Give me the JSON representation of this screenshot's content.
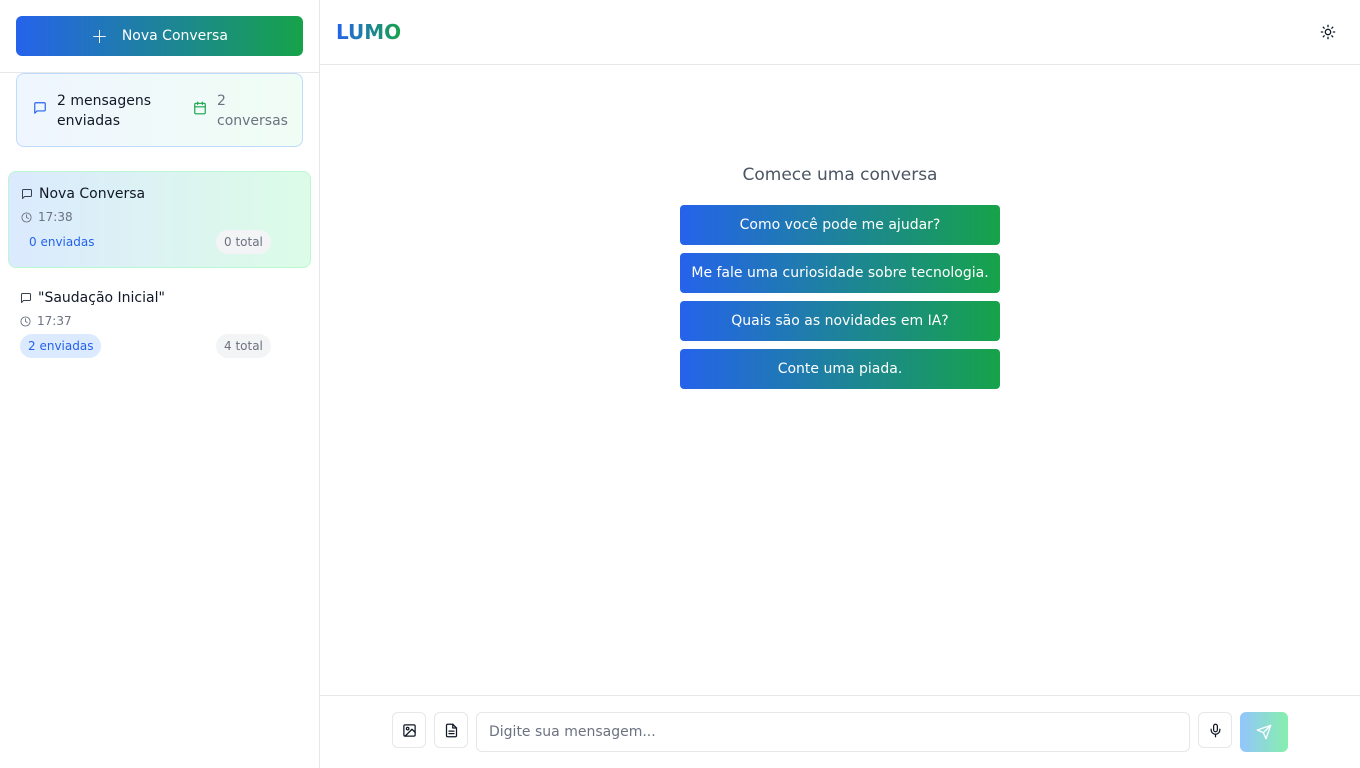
{
  "sidebar": {
    "new_chat_label": "Nova Conversa",
    "stats": {
      "messages_label": "2 mensagens enviadas",
      "conversations_label": "2 conversas"
    },
    "conversations": [
      {
        "title": "Nova Conversa",
        "time": "17:38",
        "sent": "0 enviadas",
        "total": "0 total",
        "active": true
      },
      {
        "title": "\"Saudação Inicial\"",
        "time": "17:37",
        "sent": "2 enviadas",
        "total": "4 total",
        "active": false
      }
    ]
  },
  "header": {
    "brand": "LUMO",
    "theme_icon": "sun-icon"
  },
  "main": {
    "welcome_title": "Comece uma conversa",
    "suggestions": [
      "Como você pode me ajudar?",
      "Me fale uma curiosidade sobre tecnologia.",
      "Quais são as novidades em IA?",
      "Conte uma piada."
    ]
  },
  "composer": {
    "placeholder": "Digite sua mensagem...",
    "value": ""
  },
  "colors": {
    "accent_blue": "#2563eb",
    "accent_green": "#16a34a"
  }
}
